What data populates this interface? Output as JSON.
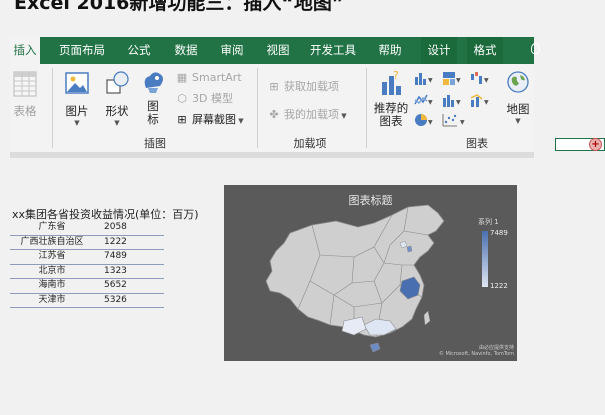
{
  "page_title": "Excel 2016新增功能三：插入“地图”",
  "ribbon": {
    "tabs": [
      {
        "label": "插入",
        "active": true
      },
      {
        "label": "页面布局"
      },
      {
        "label": "公式"
      },
      {
        "label": "数据"
      },
      {
        "label": "审阅"
      },
      {
        "label": "视图"
      },
      {
        "label": "开发工具"
      },
      {
        "label": "帮助"
      },
      {
        "label": "设计"
      },
      {
        "label": "格式"
      }
    ],
    "groups": {
      "table": {
        "label": "表格"
      },
      "illustrations": {
        "label": "插图",
        "pictures": "图片",
        "shapes": "形状",
        "icons": "图\n标",
        "smartart": "SmartArt",
        "model3d": "3D 模型",
        "screenshot": "屏幕截图"
      },
      "addins": {
        "label": "加载项",
        "get_addins": "获取加载项",
        "my_addins": "我的加载项"
      },
      "charts": {
        "label": "图表",
        "recommended": "推荐的\n图表",
        "map": "地图"
      }
    }
  },
  "table": {
    "title": "xx集团各省投资收益情况(单位：百万)",
    "rows": [
      {
        "province": "广东省",
        "value": "2058"
      },
      {
        "province": "广西壮族自治区",
        "value": "1222"
      },
      {
        "province": "江苏省",
        "value": "7489"
      },
      {
        "province": "北京市",
        "value": "1323"
      },
      {
        "province": "海南市",
        "value": "5652"
      },
      {
        "province": "天津市",
        "value": "5326"
      }
    ]
  },
  "chart": {
    "title": "图表标题",
    "legend_title": "系列 1",
    "legend_max": "7489",
    "legend_min": "1222",
    "credit": "由必应提供支持\n© Microsoft, Navinfo, TomTom"
  },
  "colors": {
    "accent": "#217346",
    "chart_bg": "#5a5a5a",
    "map_land": "#cfcfcf",
    "map_high": "#4a6fb0",
    "map_low": "#dfe6f3"
  }
}
